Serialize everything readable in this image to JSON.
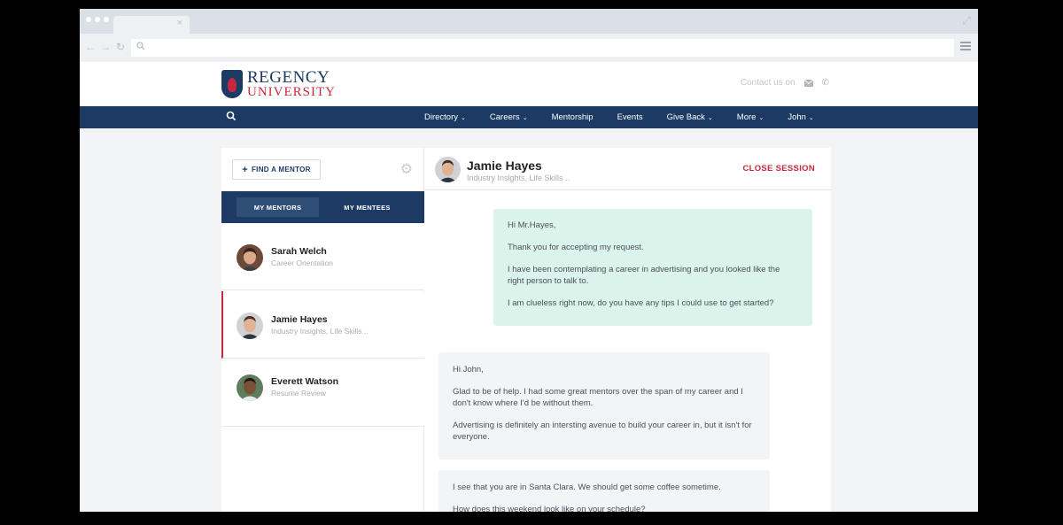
{
  "browser": {
    "tab_close": "×"
  },
  "brand": {
    "line1": "REGENCY",
    "line2": "UNIVERSITY"
  },
  "contact": {
    "label": "Contact us on"
  },
  "nav": {
    "items": [
      {
        "label": "Directory",
        "dropdown": true
      },
      {
        "label": "Careers",
        "dropdown": true
      },
      {
        "label": "Mentorship",
        "dropdown": false
      },
      {
        "label": "Events",
        "dropdown": false
      },
      {
        "label": "Give Back",
        "dropdown": true
      },
      {
        "label": "More",
        "dropdown": true
      },
      {
        "label": "John",
        "dropdown": true
      }
    ]
  },
  "sidebar": {
    "find_mentor": "FIND A MENTOR",
    "tabs": [
      "MY MENTORS",
      "MY MENTEES"
    ],
    "mentors": [
      {
        "name": "Sarah Welch",
        "subtitle": "Career Orientation"
      },
      {
        "name": "Jamie Hayes",
        "subtitle": "Industry Insights, Life Skills .."
      },
      {
        "name": "Everett Watson",
        "subtitle": "Resume Review"
      }
    ]
  },
  "chat": {
    "name": "Jamie Hayes",
    "subtitle": "Industry Insights, Life Skills ..",
    "close_label": "CLOSE SESSION",
    "messages": {
      "sent": [
        "Hi Mr.Hayes,",
        "Thank you for accepting my request.",
        "I have been contemplating a career in advertising and you looked like the right person to talk to.",
        "I am clueless right now, do you have any tips I could use to get started?"
      ],
      "received1": [
        "Hi John,",
        "Glad to be of help. I had some great mentors over the span of my career and I don't know where I'd be without them.",
        "Advertising is definitely an intersting avenue to build your career in, but it isn't for everyone."
      ],
      "received2": [
        "I see that you are in Santa Clara. We should get some coffee sometime.",
        "How does this weekend look like on your schedule?"
      ]
    }
  },
  "colors": {
    "navy": "#1c3a63",
    "accent_red": "#c8283d",
    "sent_bubble": "#daf3eb",
    "received_bubble": "#f3f4f6"
  }
}
